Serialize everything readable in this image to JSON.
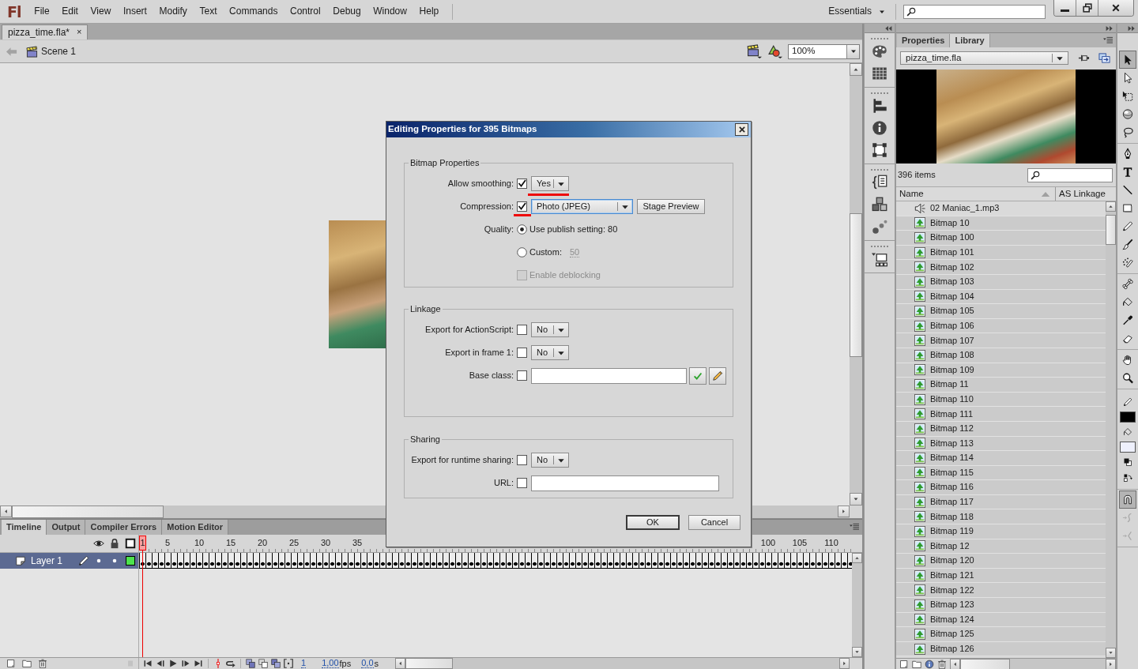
{
  "app": {
    "logo": "Fl"
  },
  "menu": [
    "File",
    "Edit",
    "View",
    "Insert",
    "Modify",
    "Text",
    "Commands",
    "Control",
    "Debug",
    "Window",
    "Help"
  ],
  "workspace": {
    "label": "Essentials"
  },
  "document_tabs": [
    {
      "label": "pizza_time.fla*",
      "close": "×",
      "selected": true
    }
  ],
  "edit_bar": {
    "scene": "Scene 1",
    "zoom": "100%"
  },
  "timeline": {
    "tabs": [
      {
        "label": "Timeline",
        "selected": true
      },
      {
        "label": "Output",
        "selected": false
      },
      {
        "label": "Compiler Errors",
        "selected": false
      },
      {
        "label": "Motion Editor",
        "selected": false
      }
    ],
    "playhead": "1",
    "ruler_start": [
      "5",
      "10",
      "15",
      "20",
      "25",
      "30",
      "35"
    ],
    "ruler_end": [
      "100",
      "105",
      "110"
    ],
    "layers": [
      {
        "name": "Layer 1",
        "selected": true,
        "color": "#4de34d",
        "keyframes": true
      }
    ],
    "frame": "1",
    "fps": "1,00",
    "fps_unit": "fps",
    "time": "0,0",
    "time_unit": "s"
  },
  "panel": {
    "tabs": [
      {
        "label": "Properties",
        "selected": false
      },
      {
        "label": "Library",
        "selected": true
      }
    ],
    "library": "pizza_time.fla",
    "count": "396 items",
    "columns": [
      "Name",
      "AS Linkage"
    ],
    "items": [
      {
        "name": "02 Maniac_1.mp3",
        "kind": "sound",
        "selected": false
      },
      {
        "name": "Bitmap 10",
        "kind": "bitmap",
        "selected": true
      },
      {
        "name": "Bitmap 100",
        "kind": "bitmap",
        "selected": true
      },
      {
        "name": "Bitmap 101",
        "kind": "bitmap",
        "selected": true
      },
      {
        "name": "Bitmap 102",
        "kind": "bitmap",
        "selected": true
      },
      {
        "name": "Bitmap 103",
        "kind": "bitmap",
        "selected": true
      },
      {
        "name": "Bitmap 104",
        "kind": "bitmap",
        "selected": true
      },
      {
        "name": "Bitmap 105",
        "kind": "bitmap",
        "selected": true
      },
      {
        "name": "Bitmap 106",
        "kind": "bitmap",
        "selected": true
      },
      {
        "name": "Bitmap 107",
        "kind": "bitmap",
        "selected": true
      },
      {
        "name": "Bitmap 108",
        "kind": "bitmap",
        "selected": true
      },
      {
        "name": "Bitmap 109",
        "kind": "bitmap",
        "selected": true
      },
      {
        "name": "Bitmap 11",
        "kind": "bitmap",
        "selected": true
      },
      {
        "name": "Bitmap 110",
        "kind": "bitmap",
        "selected": true
      },
      {
        "name": "Bitmap 111",
        "kind": "bitmap",
        "selected": true
      },
      {
        "name": "Bitmap 112",
        "kind": "bitmap",
        "selected": true
      },
      {
        "name": "Bitmap 113",
        "kind": "bitmap",
        "selected": true
      },
      {
        "name": "Bitmap 114",
        "kind": "bitmap",
        "selected": true
      },
      {
        "name": "Bitmap 115",
        "kind": "bitmap",
        "selected": true
      },
      {
        "name": "Bitmap 116",
        "kind": "bitmap",
        "selected": true
      },
      {
        "name": "Bitmap 117",
        "kind": "bitmap",
        "selected": true
      },
      {
        "name": "Bitmap 118",
        "kind": "bitmap",
        "selected": true
      },
      {
        "name": "Bitmap 119",
        "kind": "bitmap",
        "selected": true
      },
      {
        "name": "Bitmap 12",
        "kind": "bitmap",
        "selected": true
      },
      {
        "name": "Bitmap 120",
        "kind": "bitmap",
        "selected": true
      },
      {
        "name": "Bitmap 121",
        "kind": "bitmap",
        "selected": true
      },
      {
        "name": "Bitmap 122",
        "kind": "bitmap",
        "selected": true
      },
      {
        "name": "Bitmap 123",
        "kind": "bitmap",
        "selected": true
      },
      {
        "name": "Bitmap 124",
        "kind": "bitmap",
        "selected": true
      },
      {
        "name": "Bitmap 125",
        "kind": "bitmap",
        "selected": true
      },
      {
        "name": "Bitmap 126",
        "kind": "bitmap",
        "selected": true
      }
    ]
  },
  "tools": {
    "groups": [
      {
        "items": [
          {
            "kind": "selection",
            "selected": true,
            "disabled": false
          },
          {
            "kind": "subselection",
            "selected": false,
            "disabled": false
          },
          {
            "kind": "free_transform",
            "selected": false,
            "disabled": false
          },
          {
            "kind": "rotation_3d",
            "selected": false,
            "disabled": false
          },
          {
            "kind": "lasso",
            "selected": false,
            "disabled": false
          }
        ]
      },
      {
        "items": [
          {
            "kind": "pen",
            "selected": false,
            "disabled": false
          },
          {
            "kind": "text",
            "selected": false,
            "disabled": false
          },
          {
            "kind": "line",
            "selected": false,
            "disabled": false
          },
          {
            "kind": "rectangle",
            "selected": false,
            "disabled": false
          },
          {
            "kind": "pencil",
            "selected": false,
            "disabled": false
          },
          {
            "kind": "brush",
            "selected": false,
            "disabled": false
          },
          {
            "kind": "deco",
            "selected": false,
            "disabled": false
          }
        ]
      },
      {
        "items": [
          {
            "kind": "bone",
            "selected": false,
            "disabled": false
          },
          {
            "kind": "paint_bucket",
            "selected": false,
            "disabled": false
          },
          {
            "kind": "eyedropper",
            "selected": false,
            "disabled": false
          },
          {
            "kind": "eraser",
            "selected": false,
            "disabled": false
          }
        ]
      },
      {
        "items": [
          {
            "kind": "hand",
            "selected": false,
            "disabled": false
          },
          {
            "kind": "zoom",
            "selected": false,
            "disabled": false
          }
        ]
      },
      {
        "items": [
          {
            "kind": "stroke_color",
            "selected": false,
            "disabled": false,
            "color": "#000000"
          },
          {
            "kind": "fill_color",
            "selected": false,
            "disabled": false,
            "color": "#eef0fc"
          },
          {
            "kind": "default_colors",
            "selected": false,
            "disabled": false
          },
          {
            "kind": "swap_colors",
            "selected": false,
            "disabled": false
          }
        ]
      },
      {
        "items": [
          {
            "kind": "snap",
            "selected": true,
            "disabled": false
          },
          {
            "kind": "smooth",
            "selected": false,
            "disabled": true
          },
          {
            "kind": "straighten",
            "selected": false,
            "disabled": true
          }
        ]
      }
    ]
  },
  "dialog": {
    "title": "Editing Properties for 395 Bitmaps",
    "sections": [
      {
        "title": "Bitmap Properties",
        "rows": [
          {
            "kind": "check_select",
            "label": "Allow smoothing:",
            "checked": true,
            "value": "Yes",
            "focused": false,
            "underline_checkbox": false,
            "underline_select": true
          },
          {
            "kind": "check_select",
            "label": "Compression:",
            "checked": true,
            "value": "Photo (JPEG)",
            "focused": true,
            "underline_checkbox": true,
            "underline_select": false,
            "button": "Stage Preview"
          },
          {
            "kind": "radio",
            "label": "Quality:",
            "selected": true,
            "text": "Use publish setting: 80"
          },
          {
            "kind": "radio",
            "selected": false,
            "text": "Custom:",
            "value": "50"
          },
          {
            "kind": "check",
            "checked": false,
            "disabled": true,
            "text": "Enable deblocking"
          }
        ]
      },
      {
        "title": "Linkage",
        "rows": [
          {
            "kind": "check_select",
            "label": "Export for ActionScript:",
            "checked": false,
            "value": "No",
            "focused": false,
            "underline_checkbox": false,
            "underline_select": false
          },
          {
            "kind": "check_select",
            "label": "Export in frame 1:",
            "checked": false,
            "value": "No",
            "focused": false,
            "underline_checkbox": false,
            "underline_select": false
          },
          {
            "kind": "check_input",
            "label": "Base class:",
            "checked": false,
            "tools": true
          }
        ]
      },
      {
        "title": "Sharing",
        "rows": [
          {
            "kind": "check_select",
            "label": "Export for runtime sharing:",
            "checked": false,
            "value": "No",
            "focused": false,
            "underline_checkbox": false,
            "underline_select": false
          },
          {
            "kind": "check_input",
            "label": "URL:",
            "checked": false,
            "tools": false
          }
        ]
      }
    ],
    "buttons": [
      {
        "label": "OK",
        "default": true
      },
      {
        "label": "Cancel",
        "default": false
      }
    ]
  }
}
